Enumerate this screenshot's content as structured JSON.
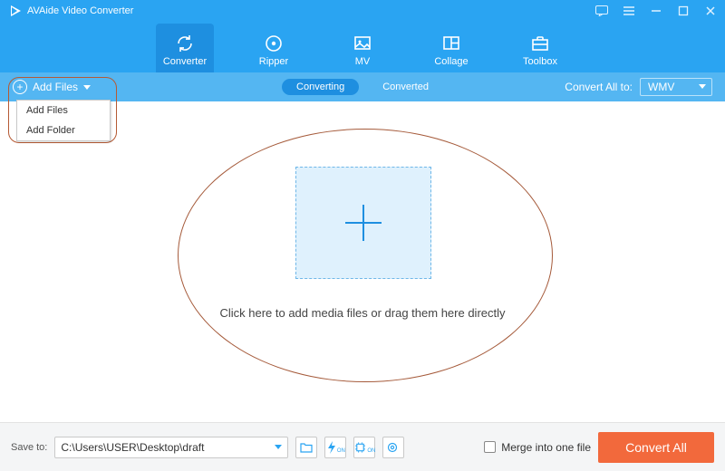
{
  "app": {
    "title": "AVAide Video Converter"
  },
  "window_buttons": [
    "feedback",
    "menu",
    "minimize",
    "maximize",
    "close"
  ],
  "main_tabs": [
    {
      "label": "Converter",
      "icon": "sync",
      "active": true
    },
    {
      "label": "Ripper",
      "icon": "disc",
      "active": false
    },
    {
      "label": "MV",
      "icon": "image",
      "active": false
    },
    {
      "label": "Collage",
      "icon": "grid",
      "active": false
    },
    {
      "label": "Toolbox",
      "icon": "briefcase",
      "active": false
    }
  ],
  "add_files": {
    "label": "Add Files",
    "menu": [
      "Add Files",
      "Add Folder"
    ]
  },
  "sub_tabs": {
    "converting": "Converting",
    "converted": "Converted",
    "active": "converting"
  },
  "convert_all": {
    "label": "Convert All to:",
    "value": "WMV"
  },
  "dropzone": {
    "text": "Click here to add media files or drag them here directly"
  },
  "footer": {
    "save_label": "Save to:",
    "save_path": "C:\\Users\\USER\\Desktop\\draft",
    "merge_label": "Merge into one file",
    "convert_label": "Convert All"
  }
}
